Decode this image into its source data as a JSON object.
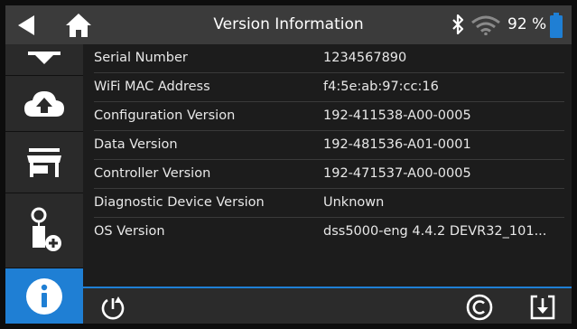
{
  "header": {
    "title": "Version Information",
    "battery_percent": "92 %",
    "icons": [
      "back-arrow-icon",
      "home-icon",
      "bluetooth-icon",
      "wifi-icon",
      "battery-icon"
    ]
  },
  "sidebar": {
    "items": [
      {
        "icon": "download-icon",
        "active": false
      },
      {
        "icon": "cloud-upload-icon",
        "active": false
      },
      {
        "icon": "shop-icon",
        "active": false
      },
      {
        "icon": "diagnostic-device-add-icon",
        "active": false
      },
      {
        "icon": "info-icon",
        "active": true
      }
    ]
  },
  "info": {
    "rows": [
      {
        "label": "Serial Number",
        "value": "1234567890"
      },
      {
        "label": "WiFi MAC Address",
        "value": "f4:5e:ab:97:cc:16"
      },
      {
        "label": "Configuration Version",
        "value": "192-411538-A00-0005"
      },
      {
        "label": "Data Version",
        "value": "192-481536-A01-0001"
      },
      {
        "label": "Controller Version",
        "value": "192-471537-A00-0005"
      },
      {
        "label": "Diagnostic Device Version",
        "value": "Unknown"
      },
      {
        "label": "OS Version",
        "value": "dss5000-eng 4.4.2 DEVR32_101..."
      }
    ]
  },
  "footer": {
    "icons": [
      "power-restart-icon",
      "copyright-icon",
      "export-icon"
    ]
  },
  "colors": {
    "accent": "#1f7fd4",
    "topbar": "#3b3b3b",
    "background": "#1c1c1c",
    "sidebar": "#2a2a2a"
  }
}
